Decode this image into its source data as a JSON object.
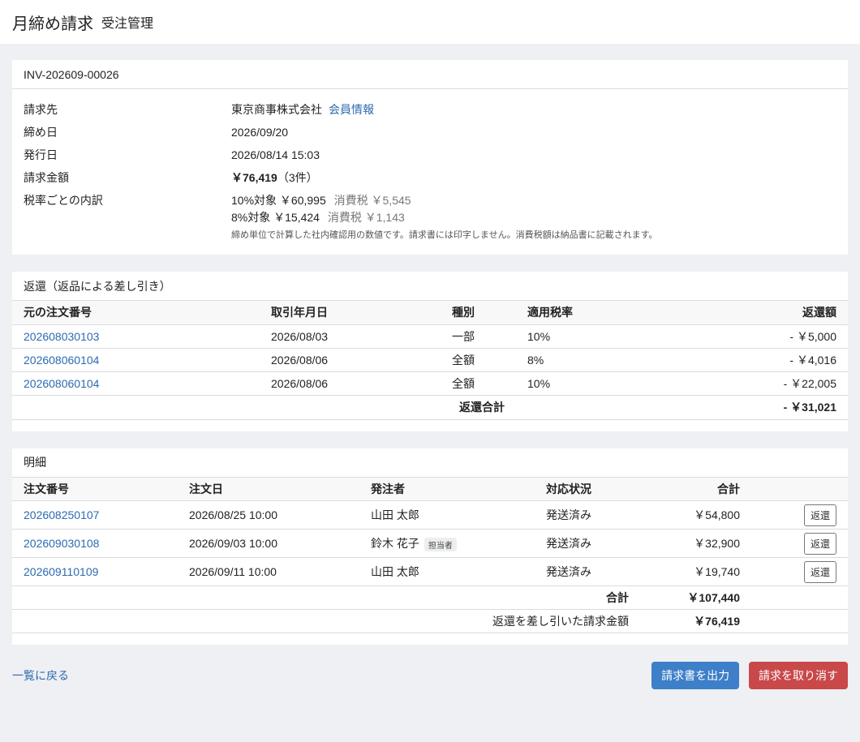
{
  "header": {
    "title": "月締め請求",
    "subtitle": "受注管理"
  },
  "invoice": {
    "number": "INV-202609-00026",
    "rows": {
      "billing_to_label": "請求先",
      "billing_to_value": "東京商事株式会社",
      "member_link": "会員情報",
      "closing_label": "締め日",
      "closing_value": "2026/09/20",
      "issue_label": "発行日",
      "issue_value": "2026/08/14 15:03",
      "amount_label": "請求金額",
      "amount_value": "￥76,419",
      "amount_count": "（3件）",
      "tax_label": "税率ごとの内訳",
      "tax_10_base": "10%対象 ￥60,995",
      "tax_10_tax": "消費税 ￥5,545",
      "tax_8_base": "8%対象 ￥15,424",
      "tax_8_tax": "消費税 ￥1,143",
      "note": "締め単位で計算した社内確認用の数値です。請求書には印字しません。消費税額は納品書に記載されます。"
    }
  },
  "refunds": {
    "title": "返還（返品による差し引き）",
    "columns": [
      "元の注文番号",
      "取引年月日",
      "種別",
      "適用税率",
      "返還額"
    ],
    "rows": [
      {
        "order": "202608030103",
        "date": "2026/08/03",
        "type": "一部",
        "rate": "10%",
        "amount": "- ￥5,000"
      },
      {
        "order": "202608060104",
        "date": "2026/08/06",
        "type": "全額",
        "rate": "8%",
        "amount": "- ￥4,016"
      },
      {
        "order": "202608060104",
        "date": "2026/08/06",
        "type": "全額",
        "rate": "10%",
        "amount": "- ￥22,005"
      }
    ],
    "total_label": "返還合計",
    "total_value": "- ￥31,021"
  },
  "details": {
    "title": "明細",
    "columns": [
      "注文番号",
      "注文日",
      "発注者",
      "対応状況",
      "合計"
    ],
    "rows": [
      {
        "order": "202608250107",
        "date": "2026/08/25 10:00",
        "orderer": "山田 太郎",
        "badge": "",
        "status": "発送済み",
        "total": "￥54,800",
        "action": "返還"
      },
      {
        "order": "202609030108",
        "date": "2026/09/03 10:00",
        "orderer": "鈴木 花子",
        "badge": "担当者",
        "status": "発送済み",
        "total": "￥32,900",
        "action": "返還"
      },
      {
        "order": "202609110109",
        "date": "2026/09/11 10:00",
        "orderer": "山田 太郎",
        "badge": "",
        "status": "発送済み",
        "total": "￥19,740",
        "action": "返還"
      }
    ],
    "sum_label": "合計",
    "sum_value": "￥107,440",
    "net_label": "返還を差し引いた請求金額",
    "net_value": "￥76,419"
  },
  "footer": {
    "back_link": "一覧に戻る",
    "export_button": "請求書を出力",
    "cancel_button": "請求を取り消す"
  },
  "colors": {
    "link": "#2d6ab0",
    "primary": "#3d7fc8",
    "danger": "#c9484a",
    "background": "#eef0f3"
  }
}
